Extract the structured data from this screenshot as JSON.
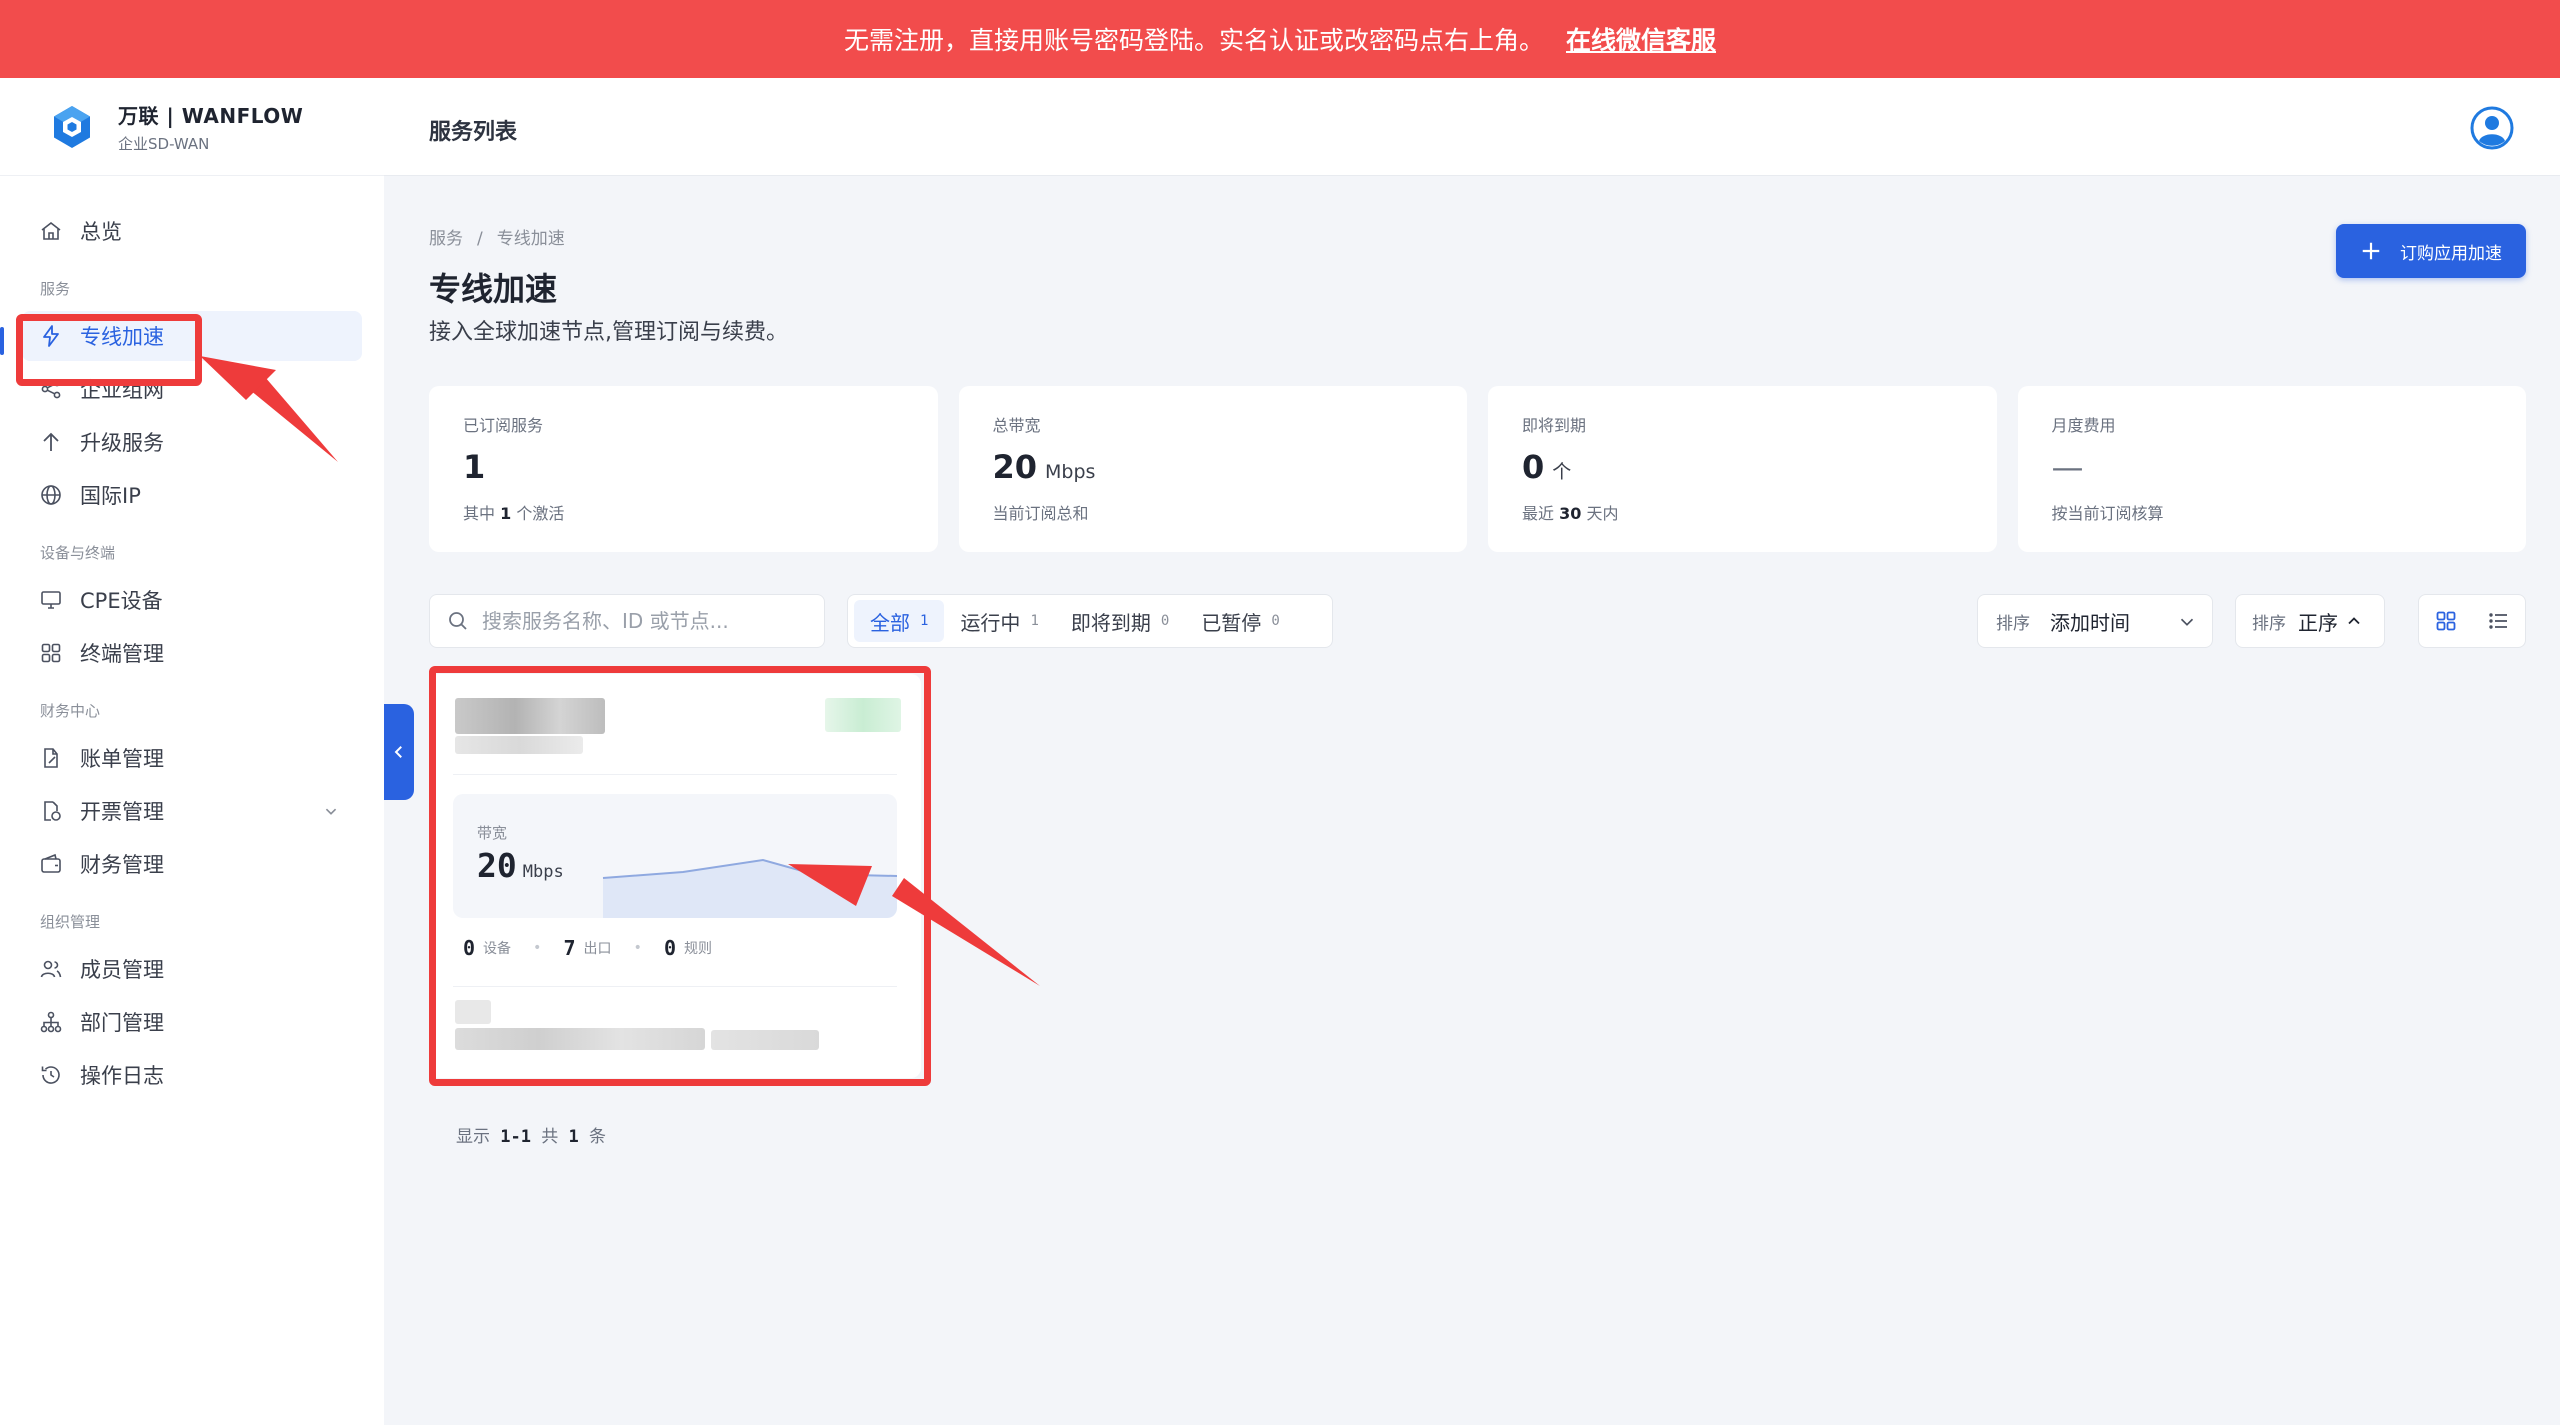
{
  "banner": {
    "message": "无需注册，直接用账号密码登陆。实名认证或改密码点右上角。",
    "link_label": "在线微信客服"
  },
  "brand": {
    "name": "万联 | WANFLOW",
    "subtitle": "企业SD-WAN"
  },
  "sidebar": {
    "overview": "总览",
    "sections": {
      "service": "服务",
      "device": "设备与终端",
      "finance": "财务中心",
      "org": "组织管理"
    },
    "items": {
      "dedicated": "专线加速",
      "network": "企业组网",
      "upgrade": "升级服务",
      "intl_ip": "国际IP",
      "cpe": "CPE设备",
      "terminal": "终端管理",
      "bill": "账单管理",
      "invoice": "开票管理",
      "fund": "财务管理",
      "members": "成员管理",
      "departments": "部门管理",
      "logs": "操作日志"
    }
  },
  "header": {
    "title": "服务列表"
  },
  "breadcrumb": {
    "root": "服务",
    "sep": "/",
    "current": "专线加速"
  },
  "page": {
    "title": "专线加速",
    "description": "接入全球加速节点,管理订阅与续费。",
    "primary_button": "订购应用加速"
  },
  "stats": [
    {
      "label": "已订阅服务",
      "value": "1",
      "unit": "",
      "note_prefix": "其中",
      "note_num": "1",
      "note_suffix": "个激活"
    },
    {
      "label": "总带宽",
      "value": "20",
      "unit": "Mbps",
      "note_prefix": "当前订阅总和",
      "note_num": "",
      "note_suffix": ""
    },
    {
      "label": "即将到期",
      "value": "0",
      "unit": "个",
      "note_prefix": "最近",
      "note_num": "30",
      "note_suffix": "天内"
    },
    {
      "label": "月度费用",
      "value": "—",
      "unit": "",
      "note_prefix": "按当前订阅核算",
      "note_num": "",
      "note_suffix": ""
    }
  ],
  "search": {
    "placeholder": "搜索服务名称、ID 或节点..."
  },
  "filters": [
    {
      "label": "全部",
      "count": "1",
      "active": true
    },
    {
      "label": "运行中",
      "count": "1",
      "active": false
    },
    {
      "label": "即将到期",
      "count": "0",
      "active": false
    },
    {
      "label": "已暂停",
      "count": "0",
      "active": false
    }
  ],
  "sort_field": {
    "label": "排序",
    "value": "添加时间"
  },
  "sort_order": {
    "label": "排序",
    "value": "正序"
  },
  "card": {
    "bandwidth_label": "带宽",
    "bandwidth_value": "20",
    "bandwidth_unit": "Mbps",
    "devices": "0",
    "devices_label": "设备",
    "exits": "7",
    "exits_label": "出口",
    "rules": "0",
    "rules_label": "规则"
  },
  "pagination": {
    "show": "显示",
    "range": "1-1",
    "total_prefix": "共",
    "total": "1",
    "total_suffix": "条"
  },
  "colors": {
    "brand_blue": "#2a62e0",
    "banner_red": "#f24c4c",
    "annotation_red": "#ee3b3b"
  }
}
